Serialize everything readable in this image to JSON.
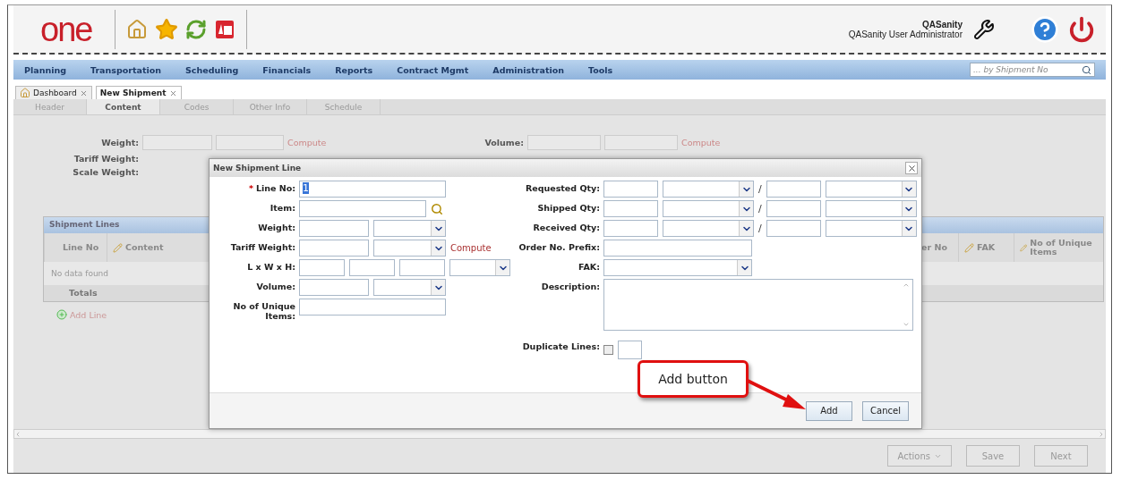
{
  "header": {
    "logo": "one",
    "user_name": "QASanity",
    "user_role": "QASanity User Administrator"
  },
  "nav": {
    "items": [
      "Planning",
      "Transportation",
      "Scheduling",
      "Financials",
      "Reports",
      "Contract Mgmt",
      "Administration",
      "Tools"
    ],
    "search": {
      "placeholder": "... by Shipment No"
    }
  },
  "doc_tabs": [
    {
      "label": "Dashboard",
      "selected": false,
      "kind": "home"
    },
    {
      "label": "New Shipment",
      "selected": true,
      "kind": "plain"
    }
  ],
  "sub_tabs": [
    {
      "label": "Header",
      "selected": false
    },
    {
      "label": "Content",
      "selected": true
    },
    {
      "label": "Codes",
      "selected": false
    },
    {
      "label": "Other Info",
      "selected": false
    },
    {
      "label": "Schedule",
      "selected": false
    }
  ],
  "background_form": {
    "left_labels": [
      "Weight:",
      "Tariff Weight:",
      "Scale Weight:"
    ],
    "left_compute": "Compute",
    "volume_label": "Volume:",
    "right_compute": "Compute"
  },
  "shipment_lines": {
    "title": "Shipment Lines",
    "left_columns": [
      {
        "label": "Line No",
        "editable": false
      },
      {
        "label": "Content",
        "editable": true
      }
    ],
    "right_columns": [
      {
        "label": "er No",
        "editable": false
      },
      {
        "label": "FAK",
        "editable": true
      },
      {
        "label": "No of Unique Items",
        "editable": true
      }
    ],
    "empty_text": "No data found",
    "totals": "Totals",
    "add_line": "Add Line"
  },
  "dialog": {
    "title": "New Shipment Line",
    "left_fields": [
      {
        "kind": "text",
        "label": "Line No:",
        "required": "*",
        "value": "1"
      },
      {
        "kind": "lookup",
        "label": "Item:"
      },
      {
        "kind": "measure",
        "label": "Weight:"
      },
      {
        "kind": "measure",
        "label": "Tariff Weight:",
        "link": "Compute"
      },
      {
        "kind": "dims",
        "label": "L x W x H:"
      },
      {
        "kind": "measure",
        "label": "Volume:"
      },
      {
        "kind": "text",
        "label": "No of Unique Items:"
      }
    ],
    "right_fields": [
      {
        "kind": "qty",
        "label": "Requested Qty:",
        "separator": "/"
      },
      {
        "kind": "qty",
        "label": "Shipped Qty:",
        "separator": "/"
      },
      {
        "kind": "qty",
        "label": "Received Qty:",
        "separator": "/"
      },
      {
        "kind": "text",
        "label": "Order No. Prefix:"
      },
      {
        "kind": "select",
        "label": "FAK:"
      },
      {
        "kind": "textarea",
        "label": "Description:"
      },
      {
        "kind": "duplicate",
        "label": "Duplicate Lines:",
        "checked": false
      }
    ],
    "buttons": [
      "Add",
      "Cancel"
    ]
  },
  "callout": {
    "text": "Add button"
  },
  "footer": {
    "buttons": [
      {
        "label": "Actions",
        "menu": true
      },
      {
        "label": "Save",
        "menu": false
      },
      {
        "label": "Next",
        "menu": false
      }
    ]
  }
}
